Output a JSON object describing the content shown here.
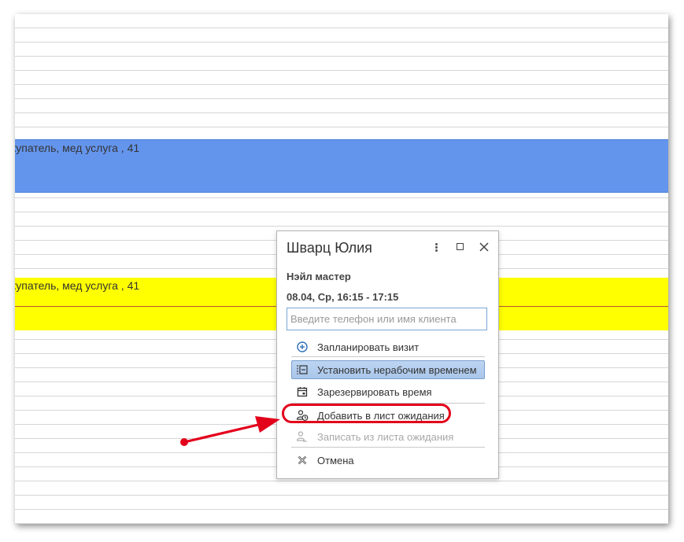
{
  "schedule": {
    "appointments": [
      {
        "text": "купатель, мед услуга , 41",
        "color": "#6495ed"
      },
      {
        "text": "купатель, мед услуга , 41",
        "color": "#ffff00"
      }
    ]
  },
  "popup": {
    "title": "Шварц Юлия",
    "master": "Нэйл мастер",
    "time": "08.04, Ср, 16:15 - 17:15",
    "client_input": {
      "value": "",
      "placeholder": "Введите телефон или имя клиента"
    },
    "menu": [
      {
        "label": "Запланировать визит",
        "icon": "plus-circle-icon",
        "enabled": true,
        "selected": false
      },
      {
        "label": "Установить нерабочим временем",
        "icon": "non-working-time-icon",
        "enabled": true,
        "selected": true
      },
      {
        "label": "Зарезервировать время",
        "icon": "calendar-icon",
        "enabled": true,
        "selected": false
      },
      {
        "label": "Добавить в лист ожидания",
        "icon": "waitlist-add-icon",
        "enabled": true,
        "selected": false,
        "highlighted": true
      },
      {
        "label": "Записать из листа ожидания",
        "icon": "waitlist-book-icon",
        "enabled": false,
        "selected": false
      },
      {
        "label": "Отмена",
        "icon": "cancel-icon",
        "enabled": true,
        "selected": false
      }
    ]
  },
  "annotation": {
    "color": "#e3001b"
  }
}
